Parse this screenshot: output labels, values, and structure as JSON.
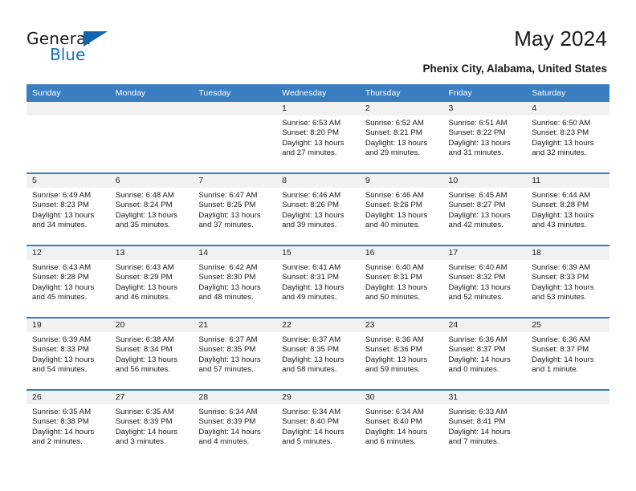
{
  "brand": {
    "name_part1": "General",
    "name_part2": "Blue",
    "color_black": "#1a1a1a",
    "color_blue": "#1271c4"
  },
  "header": {
    "title": "May 2024",
    "subtitle": "Phenix City, Alabama, United States"
  },
  "theme": {
    "header_blue": "#3a7dc0",
    "band_gray": "#f1f1f1"
  },
  "weekdays": [
    "Sunday",
    "Monday",
    "Tuesday",
    "Wednesday",
    "Thursday",
    "Friday",
    "Saturday"
  ],
  "labels": {
    "sunrise": "Sunrise:",
    "sunset": "Sunset:",
    "daylight": "Daylight:"
  },
  "weeks": [
    [
      {
        "day": "",
        "empty": true
      },
      {
        "day": "",
        "empty": true
      },
      {
        "day": "",
        "empty": true
      },
      {
        "day": "1",
        "sunrise": "Sunrise: 6:53 AM",
        "sunset": "Sunset: 8:20 PM",
        "daylight": "Daylight: 13 hours and 27 minutes."
      },
      {
        "day": "2",
        "sunrise": "Sunrise: 6:52 AM",
        "sunset": "Sunset: 8:21 PM",
        "daylight": "Daylight: 13 hours and 29 minutes."
      },
      {
        "day": "3",
        "sunrise": "Sunrise: 6:51 AM",
        "sunset": "Sunset: 8:22 PM",
        "daylight": "Daylight: 13 hours and 31 minutes."
      },
      {
        "day": "4",
        "sunrise": "Sunrise: 6:50 AM",
        "sunset": "Sunset: 8:23 PM",
        "daylight": "Daylight: 13 hours and 32 minutes."
      }
    ],
    [
      {
        "day": "5",
        "sunrise": "Sunrise: 6:49 AM",
        "sunset": "Sunset: 8:23 PM",
        "daylight": "Daylight: 13 hours and 34 minutes."
      },
      {
        "day": "6",
        "sunrise": "Sunrise: 6:48 AM",
        "sunset": "Sunset: 8:24 PM",
        "daylight": "Daylight: 13 hours and 35 minutes."
      },
      {
        "day": "7",
        "sunrise": "Sunrise: 6:47 AM",
        "sunset": "Sunset: 8:25 PM",
        "daylight": "Daylight: 13 hours and 37 minutes."
      },
      {
        "day": "8",
        "sunrise": "Sunrise: 6:46 AM",
        "sunset": "Sunset: 8:26 PM",
        "daylight": "Daylight: 13 hours and 39 minutes."
      },
      {
        "day": "9",
        "sunrise": "Sunrise: 6:46 AM",
        "sunset": "Sunset: 8:26 PM",
        "daylight": "Daylight: 13 hours and 40 minutes."
      },
      {
        "day": "10",
        "sunrise": "Sunrise: 6:45 AM",
        "sunset": "Sunset: 8:27 PM",
        "daylight": "Daylight: 13 hours and 42 minutes."
      },
      {
        "day": "11",
        "sunrise": "Sunrise: 6:44 AM",
        "sunset": "Sunset: 8:28 PM",
        "daylight": "Daylight: 13 hours and 43 minutes."
      }
    ],
    [
      {
        "day": "12",
        "sunrise": "Sunrise: 6:43 AM",
        "sunset": "Sunset: 8:28 PM",
        "daylight": "Daylight: 13 hours and 45 minutes."
      },
      {
        "day": "13",
        "sunrise": "Sunrise: 6:43 AM",
        "sunset": "Sunset: 8:29 PM",
        "daylight": "Daylight: 13 hours and 46 minutes."
      },
      {
        "day": "14",
        "sunrise": "Sunrise: 6:42 AM",
        "sunset": "Sunset: 8:30 PM",
        "daylight": "Daylight: 13 hours and 48 minutes."
      },
      {
        "day": "15",
        "sunrise": "Sunrise: 6:41 AM",
        "sunset": "Sunset: 8:31 PM",
        "daylight": "Daylight: 13 hours and 49 minutes."
      },
      {
        "day": "16",
        "sunrise": "Sunrise: 6:40 AM",
        "sunset": "Sunset: 8:31 PM",
        "daylight": "Daylight: 13 hours and 50 minutes."
      },
      {
        "day": "17",
        "sunrise": "Sunrise: 6:40 AM",
        "sunset": "Sunset: 8:32 PM",
        "daylight": "Daylight: 13 hours and 52 minutes."
      },
      {
        "day": "18",
        "sunrise": "Sunrise: 6:39 AM",
        "sunset": "Sunset: 8:33 PM",
        "daylight": "Daylight: 13 hours and 53 minutes."
      }
    ],
    [
      {
        "day": "19",
        "sunrise": "Sunrise: 6:39 AM",
        "sunset": "Sunset: 8:33 PM",
        "daylight": "Daylight: 13 hours and 54 minutes."
      },
      {
        "day": "20",
        "sunrise": "Sunrise: 6:38 AM",
        "sunset": "Sunset: 8:34 PM",
        "daylight": "Daylight: 13 hours and 56 minutes."
      },
      {
        "day": "21",
        "sunrise": "Sunrise: 6:37 AM",
        "sunset": "Sunset: 8:35 PM",
        "daylight": "Daylight: 13 hours and 57 minutes."
      },
      {
        "day": "22",
        "sunrise": "Sunrise: 6:37 AM",
        "sunset": "Sunset: 8:35 PM",
        "daylight": "Daylight: 13 hours and 58 minutes."
      },
      {
        "day": "23",
        "sunrise": "Sunrise: 6:36 AM",
        "sunset": "Sunset: 8:36 PM",
        "daylight": "Daylight: 13 hours and 59 minutes."
      },
      {
        "day": "24",
        "sunrise": "Sunrise: 6:36 AM",
        "sunset": "Sunset: 8:37 PM",
        "daylight": "Daylight: 14 hours and 0 minutes."
      },
      {
        "day": "25",
        "sunrise": "Sunrise: 6:36 AM",
        "sunset": "Sunset: 8:37 PM",
        "daylight": "Daylight: 14 hours and 1 minute."
      }
    ],
    [
      {
        "day": "26",
        "sunrise": "Sunrise: 6:35 AM",
        "sunset": "Sunset: 8:38 PM",
        "daylight": "Daylight: 14 hours and 2 minutes."
      },
      {
        "day": "27",
        "sunrise": "Sunrise: 6:35 AM",
        "sunset": "Sunset: 8:39 PM",
        "daylight": "Daylight: 14 hours and 3 minutes."
      },
      {
        "day": "28",
        "sunrise": "Sunrise: 6:34 AM",
        "sunset": "Sunset: 8:39 PM",
        "daylight": "Daylight: 14 hours and 4 minutes."
      },
      {
        "day": "29",
        "sunrise": "Sunrise: 6:34 AM",
        "sunset": "Sunset: 8:40 PM",
        "daylight": "Daylight: 14 hours and 5 minutes."
      },
      {
        "day": "30",
        "sunrise": "Sunrise: 6:34 AM",
        "sunset": "Sunset: 8:40 PM",
        "daylight": "Daylight: 14 hours and 6 minutes."
      },
      {
        "day": "31",
        "sunrise": "Sunrise: 6:33 AM",
        "sunset": "Sunset: 8:41 PM",
        "daylight": "Daylight: 14 hours and 7 minutes."
      },
      {
        "day": "",
        "empty": true
      }
    ]
  ]
}
